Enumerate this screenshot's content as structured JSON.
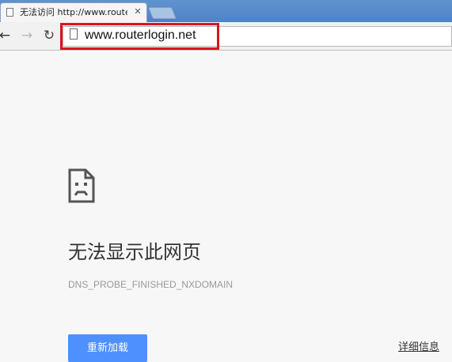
{
  "browser": {
    "tab": {
      "title": "无法访问 http://www.routerlogin.net",
      "close_icon": "close-icon"
    },
    "address_bar": {
      "url": "www.routerlogin.net"
    },
    "nav_icons": {
      "back": "back-arrow-icon",
      "forward": "forward-arrow-icon",
      "reload": "reload-icon"
    },
    "highlight_color": "#d9151f"
  },
  "error_page": {
    "icon": "sad-page-icon",
    "headline": "无法显示此网页",
    "error_code": "DNS_PROBE_FINISHED_NXDOMAIN",
    "reload_label": "重新加载",
    "details_label": "详细信息",
    "accent_color": "#4d90fe"
  }
}
